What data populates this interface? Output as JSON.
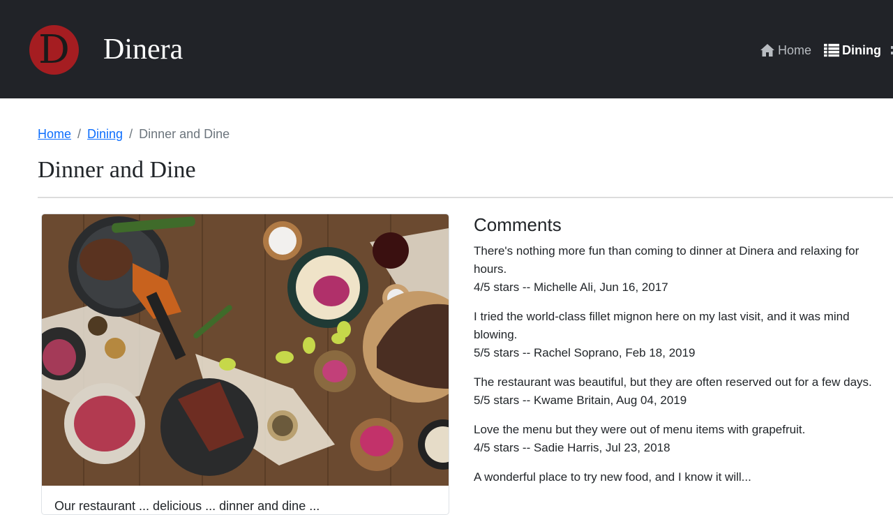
{
  "brand": {
    "name": "Dinera",
    "logo_letter": "D",
    "logo_color": "#a51d21"
  },
  "nav": {
    "items": [
      {
        "label": "Home",
        "icon": "home-icon",
        "active": false
      },
      {
        "label": "Dining",
        "icon": "list-icon",
        "active": true
      }
    ]
  },
  "breadcrumb": {
    "home": "Home",
    "dining": "Dining",
    "current": "Dinner and Dine",
    "separator": "/"
  },
  "page": {
    "title": "Dinner and Dine"
  },
  "card": {
    "image_alt": "Table of dishes: grilled steak in skillet, sweet potato fries, tacos, salads, limes and pickled onions on a wooden table",
    "text": "Our restaurant ... delicious ... dinner and dine ..."
  },
  "comments": {
    "title": "Comments",
    "items": [
      {
        "text": "There's nothing more fun than coming to dinner at Dinera and relaxing for hours.",
        "meta": "4/5 stars -- Michelle Ali, Jun 16, 2017"
      },
      {
        "text": "I tried the world-class fillet mignon here on my last visit, and it was mind blowing.",
        "meta": "5/5 stars -- Rachel Soprano, Feb 18, 2019"
      },
      {
        "text": "The restaurant was beautiful, but they are often reserved out for a few days.",
        "meta": "5/5 stars -- Kwame Britain, Aug 04, 2019"
      },
      {
        "text": "Love the menu but they were out of menu items with grapefruit.",
        "meta": "4/5 stars -- Sadie Harris, Jul 23, 2018"
      },
      {
        "text": "A wonderful place to try new food, and I know it will...",
        "meta": ""
      }
    ]
  }
}
